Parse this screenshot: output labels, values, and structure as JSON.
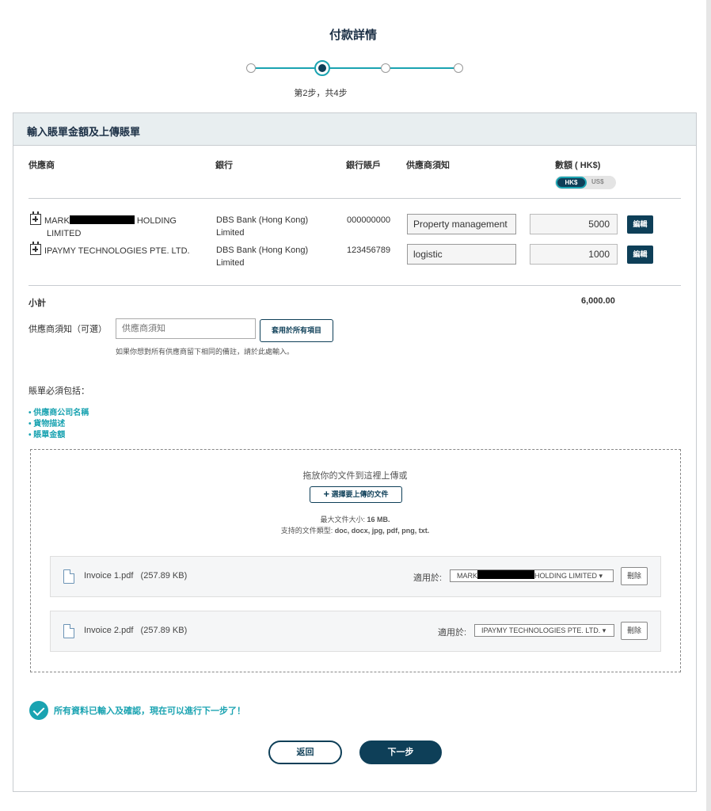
{
  "page_title": "付款詳情",
  "stepper": {
    "current_step": 2,
    "total_steps": 4,
    "label": "第2步，共4步"
  },
  "section_title": "輸入賬單金額及上傳賬單",
  "table": {
    "headers": {
      "supplier": "供應商",
      "bank": "銀行",
      "account": "銀行賬戶",
      "note": "供應商須知",
      "amount": "數額 ( HK$)"
    },
    "currency_toggle": {
      "selected": "HK$",
      "other": "US$"
    },
    "rows": [
      {
        "supplier_prefix": "MARK",
        "supplier_suffix": "HOLDING",
        "supplier_line2": "LIMITED",
        "bank_line1": "DBS Bank (Hong Kong)",
        "bank_line2": "Limited",
        "account": "000000000",
        "note": "Property management",
        "amount": "5000",
        "edit": "編輯"
      },
      {
        "supplier": "IPAYMY TECHNOLOGIES PTE. LTD.",
        "bank_line1": "DBS Bank (Hong Kong)",
        "bank_line2": "Limited",
        "account": "123456789",
        "note": "logistic",
        "amount": "1000",
        "edit": "編輯"
      }
    ]
  },
  "subtotal": {
    "label": "小計",
    "value": "6,000.00"
  },
  "notes_all": {
    "label": "供應商須知（可選）",
    "placeholder": "供應商須知",
    "apply_button": "套用於所有項目",
    "hint": "如果你想對所有供應商留下相同的備註，請於此處輸入。"
  },
  "requirements": {
    "title": "賬單必須包括：",
    "items": [
      "• 供應商公司名稱",
      "• 貨物描述",
      "• 賬單金額"
    ]
  },
  "upload": {
    "drop_text": "拖放你的文件到這裡上傳或",
    "choose_button": "選擇要上傳的文件",
    "max_size_label": "最大文件大小:",
    "max_size_value": "16 MB.",
    "types_label": "支持的文件類型:",
    "types_value": "doc, docx, jpg, pdf, png, txt.",
    "files": [
      {
        "name": "Invoice 1.pdf",
        "size": "(257.89 KB)",
        "applies_label": "適用於:",
        "applies_prefix": "MARK",
        "applies_suffix": "HOLDING LIMITED",
        "delete": "刪除"
      },
      {
        "name": "Invoice 2.pdf",
        "size": "(257.89 KB)",
        "applies_label": "適用於:",
        "applies_value": "IPAYMY TECHNOLOGIES PTE. LTD.",
        "delete": "刪除"
      }
    ]
  },
  "confirmation": "所有資料已輸入及確認，現在可以進行下一步了！",
  "buttons": {
    "back": "返回",
    "next": "下一步"
  },
  "colors": {
    "navy": "#0e3f58",
    "teal": "#1aa3b1",
    "header_bg": "#e8eef0"
  }
}
